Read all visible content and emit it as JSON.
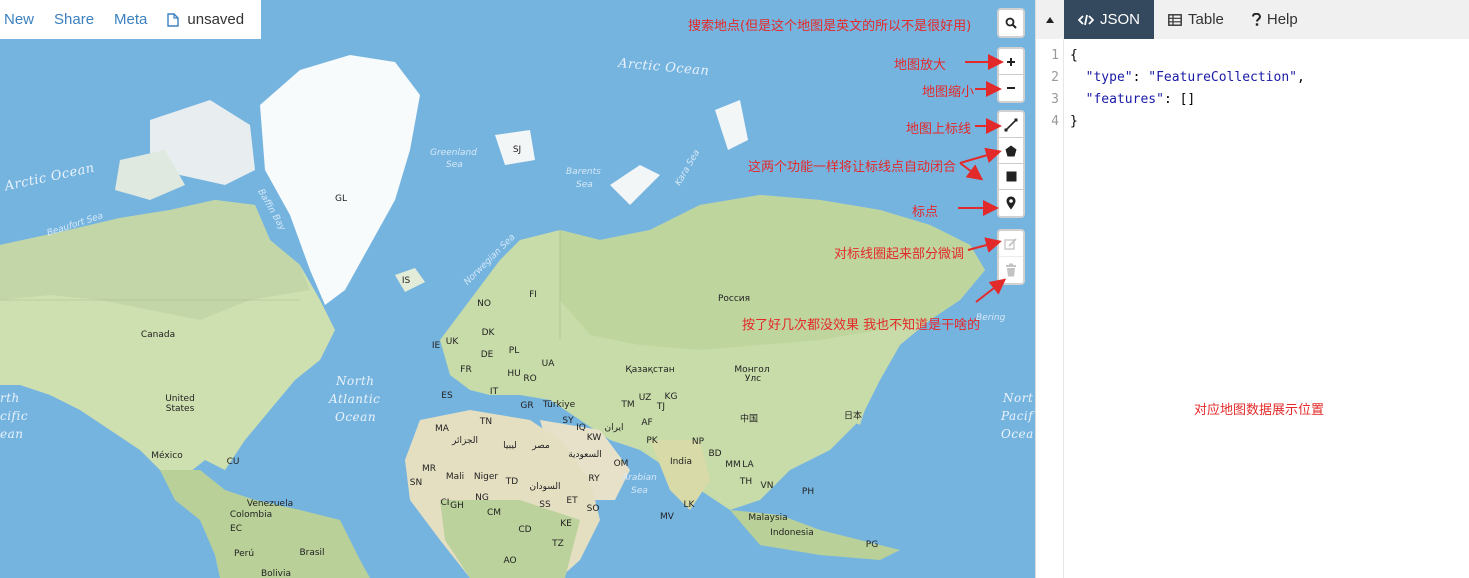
{
  "menu": {
    "new_label": "New",
    "share_label": "Share",
    "meta_label": "Meta",
    "file_label": "unsaved"
  },
  "panel": {
    "tabs": {
      "json": "JSON",
      "table": "Table",
      "help": "Help"
    },
    "line_numbers": [
      "1",
      "2",
      "3",
      "4"
    ],
    "code": {
      "line1": "{",
      "type_key": "\"type\"",
      "type_value": "\"FeatureCollection\"",
      "features_key": "\"features\"",
      "features_value": "[]",
      "line4": "}"
    },
    "annotation": "对应地图数据展示位置"
  },
  "annotations": {
    "search": "搜索地点(但是这个地图是英文的所以不是很好用)",
    "zoom_in": "地图放大",
    "zoom_out": "地图缩小",
    "draw_line": "地图上标线",
    "polygon_rect": "这两个功能一样将让标线点自动闭合",
    "marker": "标点",
    "edit": "对标线圈起来部分微调",
    "delete": "按了好几次都没效果 我也不知道是干啥的"
  },
  "map": {
    "oceans": {
      "arctic1": "Arctic Ocean",
      "arctic2": "Arctic Ocean",
      "north_atlantic1": "North",
      "north_atlantic2": "Atlantic",
      "north_atlantic3": "Ocean",
      "north_pacific_w1": "rth",
      "north_pacific_w2": "cific",
      "north_pacific_w3": "ean",
      "north_pacific_e1": "Nort",
      "north_pacific_e2": "Pacif",
      "north_pacific_e3": "Ocea"
    },
    "seas": {
      "beaufort": "Beaufort Sea",
      "baffin": "Baffin Bay",
      "greenland1": "Greenland",
      "greenland2": "Sea",
      "norwegian": "Norwegian Sea",
      "barents1": "Barents",
      "barents2": "Sea",
      "kara": "Kara Sea",
      "arabian1": "Arabian",
      "arabian2": "Sea",
      "bering": "Bering"
    },
    "countries": {
      "gl": "GL",
      "sj": "SJ",
      "is": "IS",
      "no": "NO",
      "fi": "FI",
      "ie": "IE",
      "uk": "UK",
      "dk": "DK",
      "de": "DE",
      "pl": "PL",
      "ua": "UA",
      "fr": "FR",
      "hu": "HU",
      "ro": "RO",
      "es": "ES",
      "it": "IT",
      "gr": "GR",
      "tr": "Türkiye",
      "sy": "SY",
      "iq": "IQ",
      "ir": "ایران",
      "kw": "KW",
      "ma": "MA",
      "tn": "TN",
      "dz": "الجزائر",
      "ly": "ليبيا",
      "eg": "مصر",
      "sa": "السعودية",
      "om": "OM",
      "ry": "RY",
      "af": "AF",
      "pk": "PK",
      "in": "India",
      "np": "NP",
      "bd": "BD",
      "mm": "MM",
      "la": "LA",
      "th": "TH",
      "vn": "VN",
      "kz": "Қазақстан",
      "ru": "Россия",
      "mn1": "Монгол",
      "mn2": "Улс",
      "cn": "中国",
      "jp": "日本",
      "tm": "TM",
      "uz": "UZ",
      "kg": "KG",
      "tj": "TJ",
      "mr": "MR",
      "ml": "Mali",
      "ne": "Niger",
      "td": "TD",
      "sd": "السودان",
      "sn": "SN",
      "ci": "CI",
      "gh": "GH",
      "ng": "NG",
      "ss": "SS",
      "et": "ET",
      "so": "SO",
      "ke": "KE",
      "cm": "CM",
      "cd": "CD",
      "tz": "TZ",
      "ao": "AO",
      "mv": "MV",
      "lk": "LK",
      "my": "Malaysia",
      "id": "Indonesia",
      "ph": "PH",
      "pg": "PG",
      "ca": "Canada",
      "us1": "United",
      "us2": "States",
      "mx": "México",
      "cu": "CU",
      "ve": "Venezuela",
      "co": "Colombia",
      "ec": "EC",
      "pe": "Perú",
      "br": "Brasil",
      "bo": "Bolivia"
    }
  }
}
